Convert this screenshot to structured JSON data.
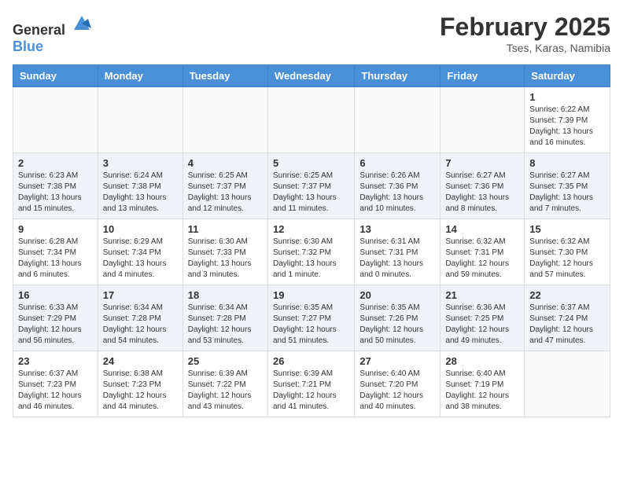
{
  "logo": {
    "general": "General",
    "blue": "Blue"
  },
  "header": {
    "month_year": "February 2025",
    "location": "Tses, Karas, Namibia"
  },
  "weekdays": [
    "Sunday",
    "Monday",
    "Tuesday",
    "Wednesday",
    "Thursday",
    "Friday",
    "Saturday"
  ],
  "weeks": [
    {
      "shaded": false,
      "days": [
        {
          "number": "",
          "info": ""
        },
        {
          "number": "",
          "info": ""
        },
        {
          "number": "",
          "info": ""
        },
        {
          "number": "",
          "info": ""
        },
        {
          "number": "",
          "info": ""
        },
        {
          "number": "",
          "info": ""
        },
        {
          "number": "1",
          "info": "Sunrise: 6:22 AM\nSunset: 7:39 PM\nDaylight: 13 hours and 16 minutes."
        }
      ]
    },
    {
      "shaded": true,
      "days": [
        {
          "number": "2",
          "info": "Sunrise: 6:23 AM\nSunset: 7:38 PM\nDaylight: 13 hours and 15 minutes."
        },
        {
          "number": "3",
          "info": "Sunrise: 6:24 AM\nSunset: 7:38 PM\nDaylight: 13 hours and 13 minutes."
        },
        {
          "number": "4",
          "info": "Sunrise: 6:25 AM\nSunset: 7:37 PM\nDaylight: 13 hours and 12 minutes."
        },
        {
          "number": "5",
          "info": "Sunrise: 6:25 AM\nSunset: 7:37 PM\nDaylight: 13 hours and 11 minutes."
        },
        {
          "number": "6",
          "info": "Sunrise: 6:26 AM\nSunset: 7:36 PM\nDaylight: 13 hours and 10 minutes."
        },
        {
          "number": "7",
          "info": "Sunrise: 6:27 AM\nSunset: 7:36 PM\nDaylight: 13 hours and 8 minutes."
        },
        {
          "number": "8",
          "info": "Sunrise: 6:27 AM\nSunset: 7:35 PM\nDaylight: 13 hours and 7 minutes."
        }
      ]
    },
    {
      "shaded": false,
      "days": [
        {
          "number": "9",
          "info": "Sunrise: 6:28 AM\nSunset: 7:34 PM\nDaylight: 13 hours and 6 minutes."
        },
        {
          "number": "10",
          "info": "Sunrise: 6:29 AM\nSunset: 7:34 PM\nDaylight: 13 hours and 4 minutes."
        },
        {
          "number": "11",
          "info": "Sunrise: 6:30 AM\nSunset: 7:33 PM\nDaylight: 13 hours and 3 minutes."
        },
        {
          "number": "12",
          "info": "Sunrise: 6:30 AM\nSunset: 7:32 PM\nDaylight: 13 hours and 1 minute."
        },
        {
          "number": "13",
          "info": "Sunrise: 6:31 AM\nSunset: 7:31 PM\nDaylight: 13 hours and 0 minutes."
        },
        {
          "number": "14",
          "info": "Sunrise: 6:32 AM\nSunset: 7:31 PM\nDaylight: 12 hours and 59 minutes."
        },
        {
          "number": "15",
          "info": "Sunrise: 6:32 AM\nSunset: 7:30 PM\nDaylight: 12 hours and 57 minutes."
        }
      ]
    },
    {
      "shaded": true,
      "days": [
        {
          "number": "16",
          "info": "Sunrise: 6:33 AM\nSunset: 7:29 PM\nDaylight: 12 hours and 56 minutes."
        },
        {
          "number": "17",
          "info": "Sunrise: 6:34 AM\nSunset: 7:28 PM\nDaylight: 12 hours and 54 minutes."
        },
        {
          "number": "18",
          "info": "Sunrise: 6:34 AM\nSunset: 7:28 PM\nDaylight: 12 hours and 53 minutes."
        },
        {
          "number": "19",
          "info": "Sunrise: 6:35 AM\nSunset: 7:27 PM\nDaylight: 12 hours and 51 minutes."
        },
        {
          "number": "20",
          "info": "Sunrise: 6:35 AM\nSunset: 7:26 PM\nDaylight: 12 hours and 50 minutes."
        },
        {
          "number": "21",
          "info": "Sunrise: 6:36 AM\nSunset: 7:25 PM\nDaylight: 12 hours and 49 minutes."
        },
        {
          "number": "22",
          "info": "Sunrise: 6:37 AM\nSunset: 7:24 PM\nDaylight: 12 hours and 47 minutes."
        }
      ]
    },
    {
      "shaded": false,
      "days": [
        {
          "number": "23",
          "info": "Sunrise: 6:37 AM\nSunset: 7:23 PM\nDaylight: 12 hours and 46 minutes."
        },
        {
          "number": "24",
          "info": "Sunrise: 6:38 AM\nSunset: 7:23 PM\nDaylight: 12 hours and 44 minutes."
        },
        {
          "number": "25",
          "info": "Sunrise: 6:39 AM\nSunset: 7:22 PM\nDaylight: 12 hours and 43 minutes."
        },
        {
          "number": "26",
          "info": "Sunrise: 6:39 AM\nSunset: 7:21 PM\nDaylight: 12 hours and 41 minutes."
        },
        {
          "number": "27",
          "info": "Sunrise: 6:40 AM\nSunset: 7:20 PM\nDaylight: 12 hours and 40 minutes."
        },
        {
          "number": "28",
          "info": "Sunrise: 6:40 AM\nSunset: 7:19 PM\nDaylight: 12 hours and 38 minutes."
        },
        {
          "number": "",
          "info": ""
        }
      ]
    }
  ]
}
